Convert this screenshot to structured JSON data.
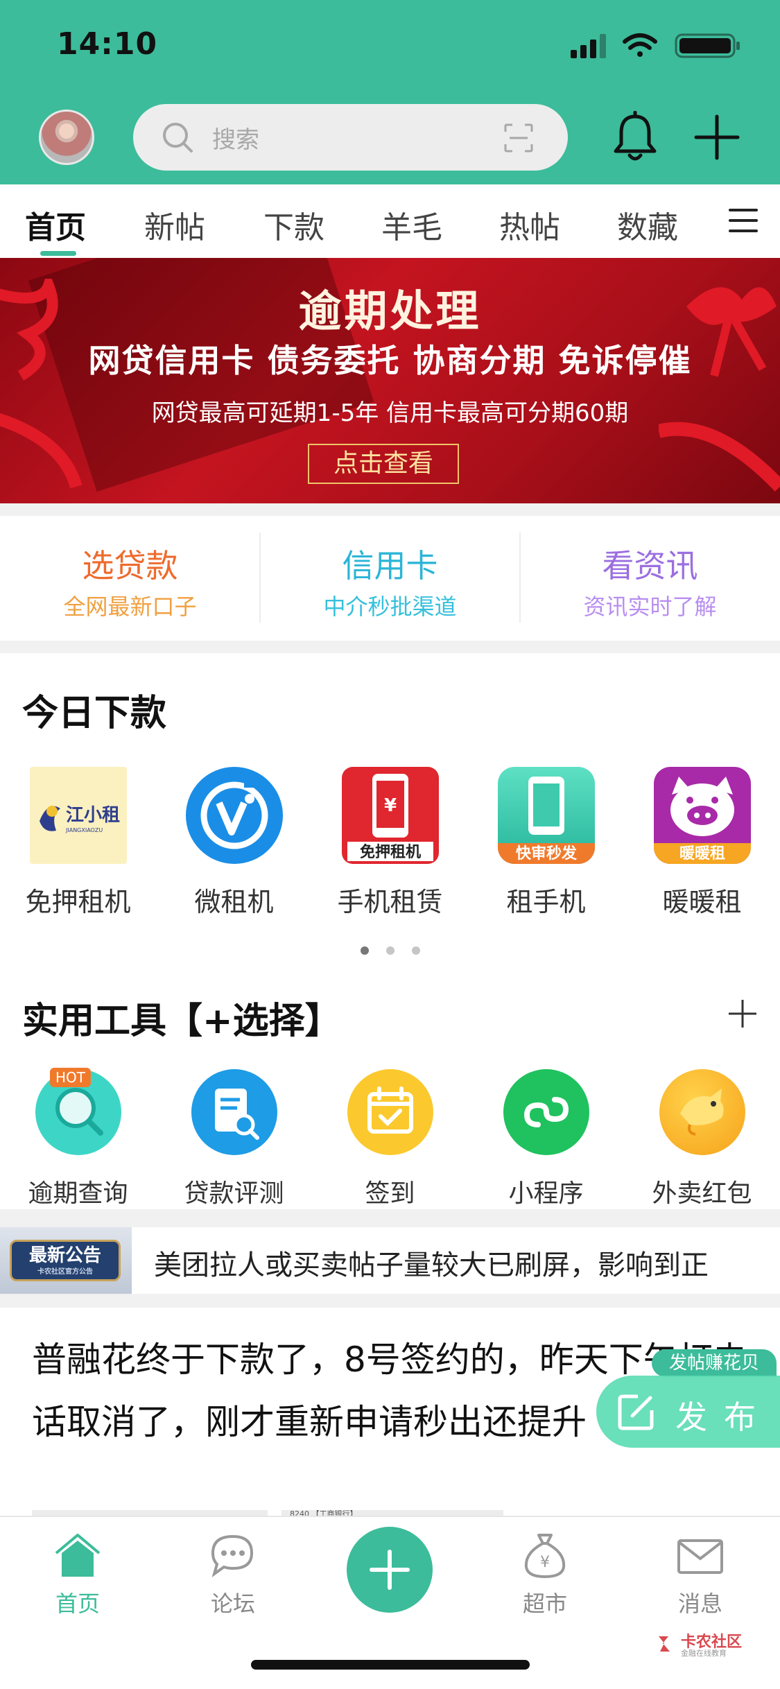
{
  "theme": {
    "accent": "#3cbc9a",
    "banner_red": "#c41420",
    "orange": "#f07a2c",
    "teal": "#2bb5d6",
    "purple": "#9b6fe0"
  },
  "status_bar": {
    "time": "14:10",
    "icons": [
      "signal-icon",
      "wifi-icon",
      "battery-icon"
    ]
  },
  "header": {
    "search_placeholder": "搜索",
    "icons": [
      "avatar",
      "search-icon",
      "scan-icon",
      "bell-icon",
      "plus-icon"
    ]
  },
  "tabs": [
    {
      "label": "首页",
      "active": true
    },
    {
      "label": "新帖"
    },
    {
      "label": "下款"
    },
    {
      "label": "羊毛"
    },
    {
      "label": "热帖"
    },
    {
      "label": "数藏"
    }
  ],
  "banner": {
    "title": "逾期处理",
    "subtitle": "网贷信用卡 债务委托 协商分期 免诉停催",
    "note": "网贷最高可延期1-5年   信用卡最高可分期60期",
    "button": "点击查看"
  },
  "quick_links": [
    {
      "title": "选贷款",
      "subtitle": "全网最新口子",
      "color": "#ee6b2d",
      "sub_color": "#f0a040"
    },
    {
      "title": "信用卡",
      "subtitle": "中介秒批渠道",
      "color": "#2bb5d6",
      "sub_color": "#35c0dc"
    },
    {
      "title": "看资讯",
      "subtitle": "资讯实时了解",
      "color": "#9b6fe0",
      "sub_color": "#b88ef0"
    }
  ],
  "today": {
    "title": "今日下款",
    "apps": [
      {
        "label": "免押租机",
        "icon": "jiangxiaozu-logo",
        "logo_text": "江小租",
        "logo_sub": "JIANGXIAOZU"
      },
      {
        "label": "微租机",
        "icon": "weizuji-logo"
      },
      {
        "label": "手机租赁",
        "icon": "phone-rental-logo",
        "logo_text": "免押租机"
      },
      {
        "label": "租手机",
        "icon": "rent-phone-logo",
        "logo_text": "快审秒发"
      },
      {
        "label": "暖暖租",
        "icon": "nuannuanzu-logo",
        "logo_text": "暖暖租"
      }
    ],
    "page_dots": 3,
    "active_dot": 0
  },
  "tools": {
    "title": "实用工具【+选择】",
    "items": [
      {
        "label": "逾期查询",
        "icon": "magnifier-icon",
        "badge": "HOT"
      },
      {
        "label": "贷款评测",
        "icon": "document-search-icon"
      },
      {
        "label": "签到",
        "icon": "calendar-check-icon"
      },
      {
        "label": "小程序",
        "icon": "mini-program-icon"
      },
      {
        "label": "外卖红包",
        "icon": "kangaroo-icon"
      }
    ]
  },
  "notice": {
    "tag": "最新公告",
    "tag_small": "卡农社区官方公告",
    "text": "美团拉人或买卖帖子量较大已刷屏，影响到正"
  },
  "post": {
    "text": "普融花终于下款了，8号签约的，昨天下午打电话取消了，刚才重新申请秒出还提升",
    "thumb_text": "8240  【工商银行】"
  },
  "fab": {
    "tag": "发帖赚花贝",
    "label": "发布"
  },
  "bottom_nav": [
    {
      "label": "首页",
      "icon": "home-icon",
      "active": true
    },
    {
      "label": "论坛",
      "icon": "chat-icon"
    },
    {
      "label": "",
      "icon": "add-icon"
    },
    {
      "label": "超市",
      "icon": "money-bag-icon"
    },
    {
      "label": "消息",
      "icon": "mail-icon"
    }
  ],
  "watermark": {
    "title": "卡农社区",
    "subtitle": "金融在线教育"
  }
}
